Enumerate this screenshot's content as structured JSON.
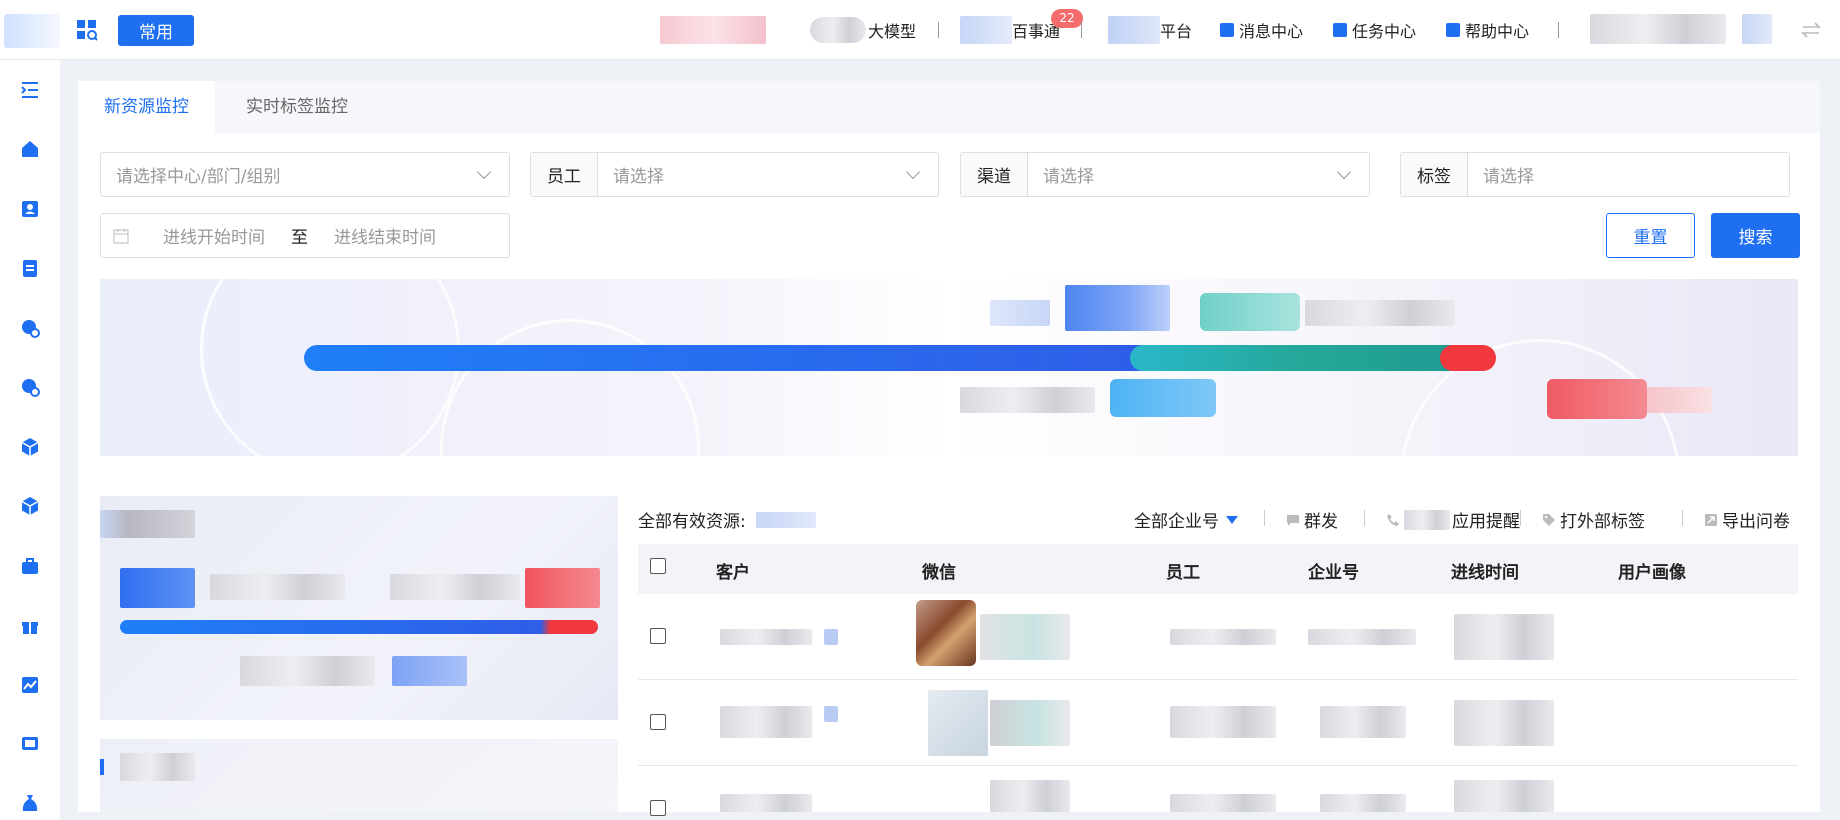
{
  "topbar": {
    "common_label": "常用",
    "nav_model": "大模型",
    "nav_baishi": "百事通",
    "badge_count": "22",
    "nav_platform": "平台",
    "nav_messages": "消息中心",
    "nav_tasks": "任务中心",
    "nav_help": "帮助中心"
  },
  "tabs": [
    {
      "label": "新资源监控",
      "active": true
    },
    {
      "label": "实时标签监控",
      "active": false
    }
  ],
  "filters": {
    "org_placeholder": "请选择中心/部门/组别",
    "employee_label": "员工",
    "employee_placeholder": "请选择",
    "channel_label": "渠道",
    "channel_placeholder": "请选择",
    "tag_label": "标签",
    "tag_placeholder": "请选择",
    "date_start_placeholder": "进线开始时间",
    "date_to": "至",
    "date_end_placeholder": "进线结束时间",
    "reset_label": "重置",
    "search_label": "搜索"
  },
  "toolbar": {
    "total_label": "全部有效资源:",
    "enterprise_filter": "全部企业号",
    "mass_send": "群发",
    "app_reminder": "应用提醒",
    "external_tag": "打外部标签",
    "export_survey": "导出问卷"
  },
  "table": {
    "columns": [
      "客户",
      "微信",
      "员工",
      "企业号",
      "进线时间",
      "用户画像"
    ]
  },
  "colors": {
    "accent": "#1f6ff2",
    "bar_blue": "#2b6ff0",
    "bar_teal": "#2bb5a8",
    "bar_red": "#f0383e"
  }
}
